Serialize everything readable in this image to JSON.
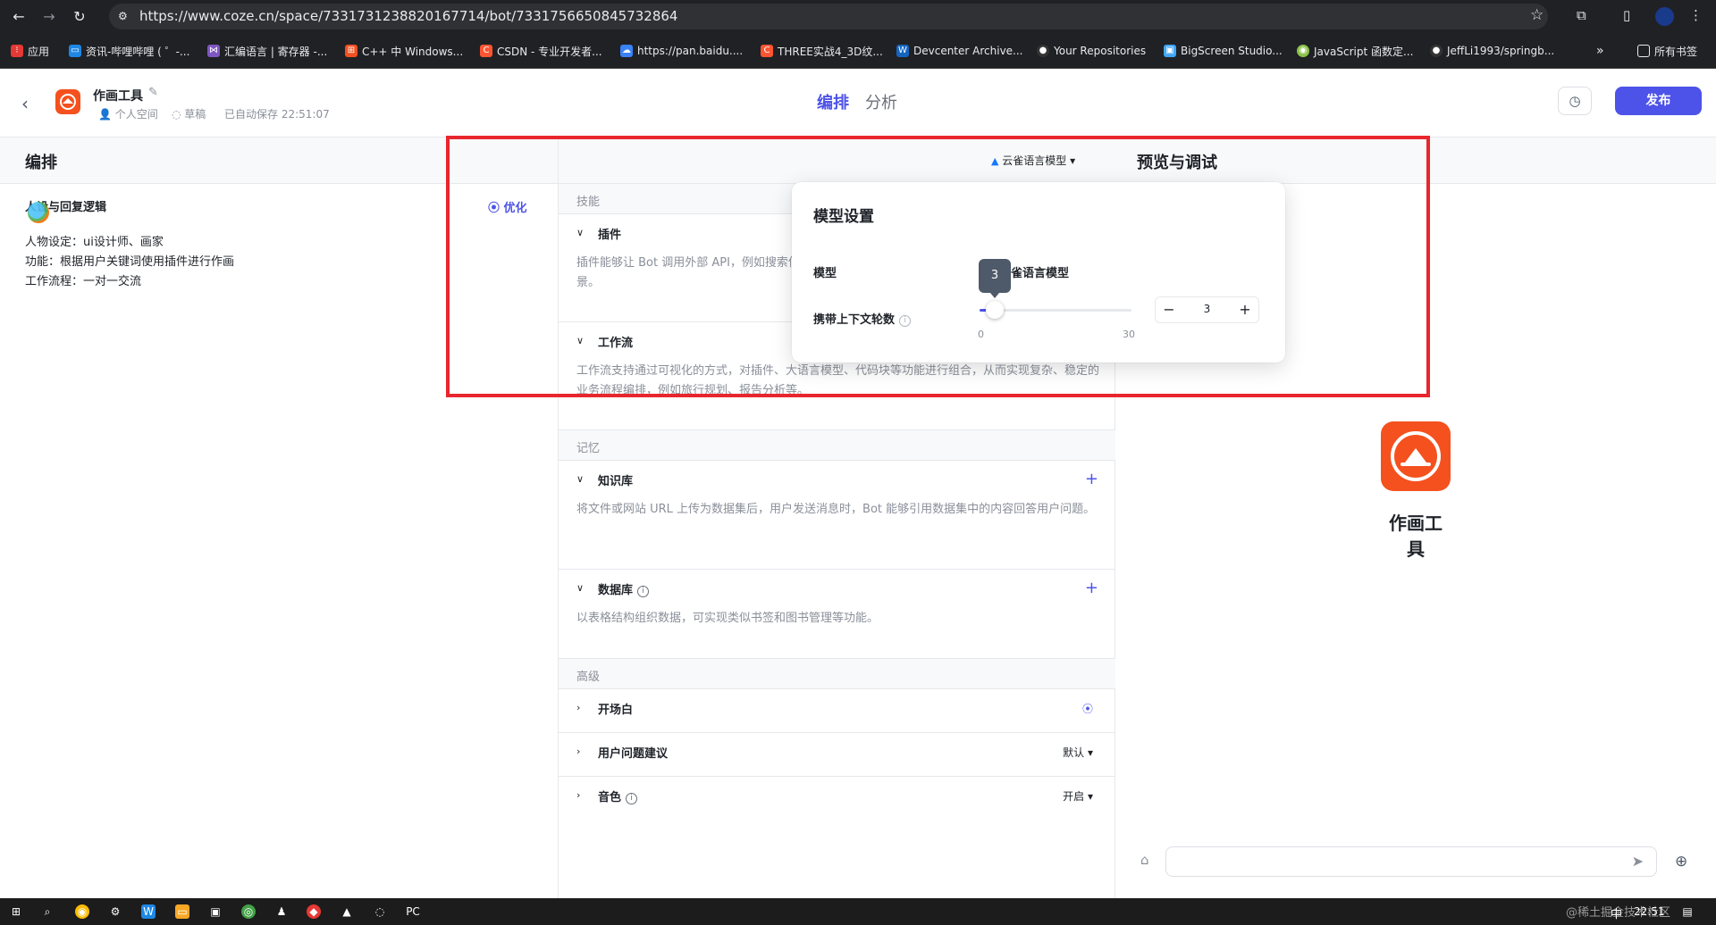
{
  "browser": {
    "url": "https://www.coze.cn/space/7331731238820167714/bot/7331756650845732864",
    "bookmarks": [
      {
        "label": "应用",
        "color": "#e8eaed"
      },
      {
        "label": "资讯-哔哩哔哩 ( ゜-...",
        "color": "#1e88e5"
      },
      {
        "label": "汇编语言 | 寄存器 -...",
        "color": "#7e57c2"
      },
      {
        "label": "C++ 中 Windows...",
        "color": "#f25022"
      },
      {
        "label": "CSDN - 专业开发者...",
        "color": "#fc5531"
      },
      {
        "label": "https://pan.baidu....",
        "color": "#3b82f6"
      },
      {
        "label": "THREE实战4_3D纹...",
        "color": "#fc5531"
      },
      {
        "label": "Devcenter Archive...",
        "color": "#1565c0"
      },
      {
        "label": "Your Repositories",
        "color": "#e8eaed"
      },
      {
        "label": "BigScreen Studio...",
        "color": "#42a5f5"
      },
      {
        "label": "JavaScript 函数定...",
        "color": "#8bc34a"
      },
      {
        "label": "JeffLi1993/springb...",
        "color": "#e8eaed"
      }
    ],
    "bookmarks_more": "»",
    "all_bookmarks": "所有书签"
  },
  "header": {
    "bot_name": "作画工具",
    "space": "个人空间",
    "status": "草稿",
    "autosave": "已自动保存 22:51:07",
    "tabs": [
      "编排",
      "分析"
    ],
    "publish": "发布"
  },
  "left": {
    "title": "编排",
    "persona_title": "人设与回复逻辑",
    "optimize": "优化",
    "lines": [
      "人物设定：ui设计师、画家",
      "功能：根据用户关键词使用插件进行作画",
      "工作流程：一对一交流"
    ]
  },
  "middle": {
    "model": "云雀语言模型",
    "sections": {
      "skills": "技能",
      "memory": "记忆",
      "advanced": "高级"
    },
    "items": {
      "plugin": {
        "title": "插件",
        "desc": "插件能够让 Bot 调用外部 API，例如搜索信息、浏览网页、生成图片等，扩展 Bot 的能力和使用场景。"
      },
      "workflow": {
        "title": "工作流",
        "desc": "工作流支持通过可视化的方式，对插件、大语言模型、代码块等功能进行组合，从而实现复杂、稳定的业务流程编排，例如旅行规划、报告分析等。"
      },
      "knowledge": {
        "title": "知识库",
        "desc": "将文件或网站 URL 上传为数据集后，用户发送消息时，Bot 能够引用数据集中的内容回答用户问题。"
      },
      "database": {
        "title": "数据库",
        "desc": "以表格结构组织数据，可实现类似书签和图书管理等功能。"
      },
      "opening": {
        "title": "开场白"
      },
      "suggest": {
        "title": "用户问题建议",
        "value": "默认"
      },
      "voice": {
        "title": "音色",
        "value": "开启"
      }
    }
  },
  "right": {
    "title": "预览与调试",
    "bot_name": "作画工具"
  },
  "popover": {
    "title": "模型设置",
    "model_label": "模型",
    "model_value": "云雀语言模型",
    "context_label": "携带上下文轮数",
    "context_value": 3,
    "context_display": "3",
    "context_min": 0,
    "context_max": 30,
    "min_label": "0",
    "max_label": "30"
  },
  "taskbar": {
    "time": "22:51",
    "ime": "中",
    "watermark": "@稀土掘金技术社区"
  },
  "colors": {
    "accent": "#4d53e8",
    "brand": "#f4511e",
    "annotation": "#e8262d"
  }
}
